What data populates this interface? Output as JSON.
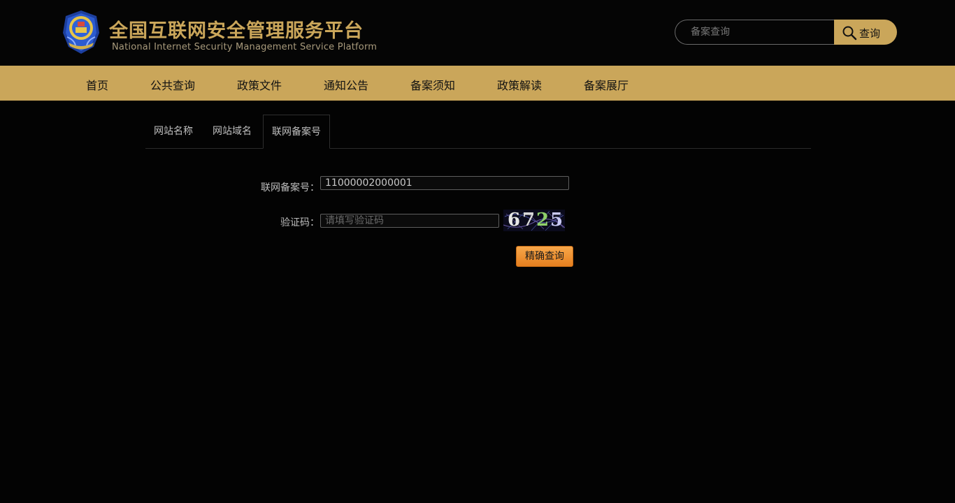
{
  "header": {
    "title": "全国互联网安全管理服务平台",
    "subtitle": "National Internet Security Management Service Platform",
    "logo_icon": "police-emblem-icon",
    "search": {
      "placeholder": "备案查询",
      "value": "",
      "button_label": "查询",
      "button_icon": "search-icon"
    }
  },
  "nav": {
    "items": [
      {
        "label": "首页"
      },
      {
        "label": "公共查询"
      },
      {
        "label": "政策文件"
      },
      {
        "label": "通知公告"
      },
      {
        "label": "备案须知"
      },
      {
        "label": "政策解读"
      },
      {
        "label": "备案展厅"
      }
    ]
  },
  "tabs": {
    "items": [
      {
        "label": "网站名称"
      },
      {
        "label": "网站域名"
      },
      {
        "label": "联网备案号"
      }
    ],
    "active": "联网备案号"
  },
  "form": {
    "record_number_label": "联网备案号：",
    "record_number_value": "11000002000001",
    "captcha_label": "验证码：",
    "captcha_placeholder": "请填写验证码",
    "captcha_value": "",
    "captcha_digits": [
      "6",
      "7",
      "2",
      "5"
    ],
    "submit_label": "精确查询"
  },
  "colors": {
    "accent": "#caa65a",
    "background": "#030303",
    "submit_button": "#f0962f"
  }
}
